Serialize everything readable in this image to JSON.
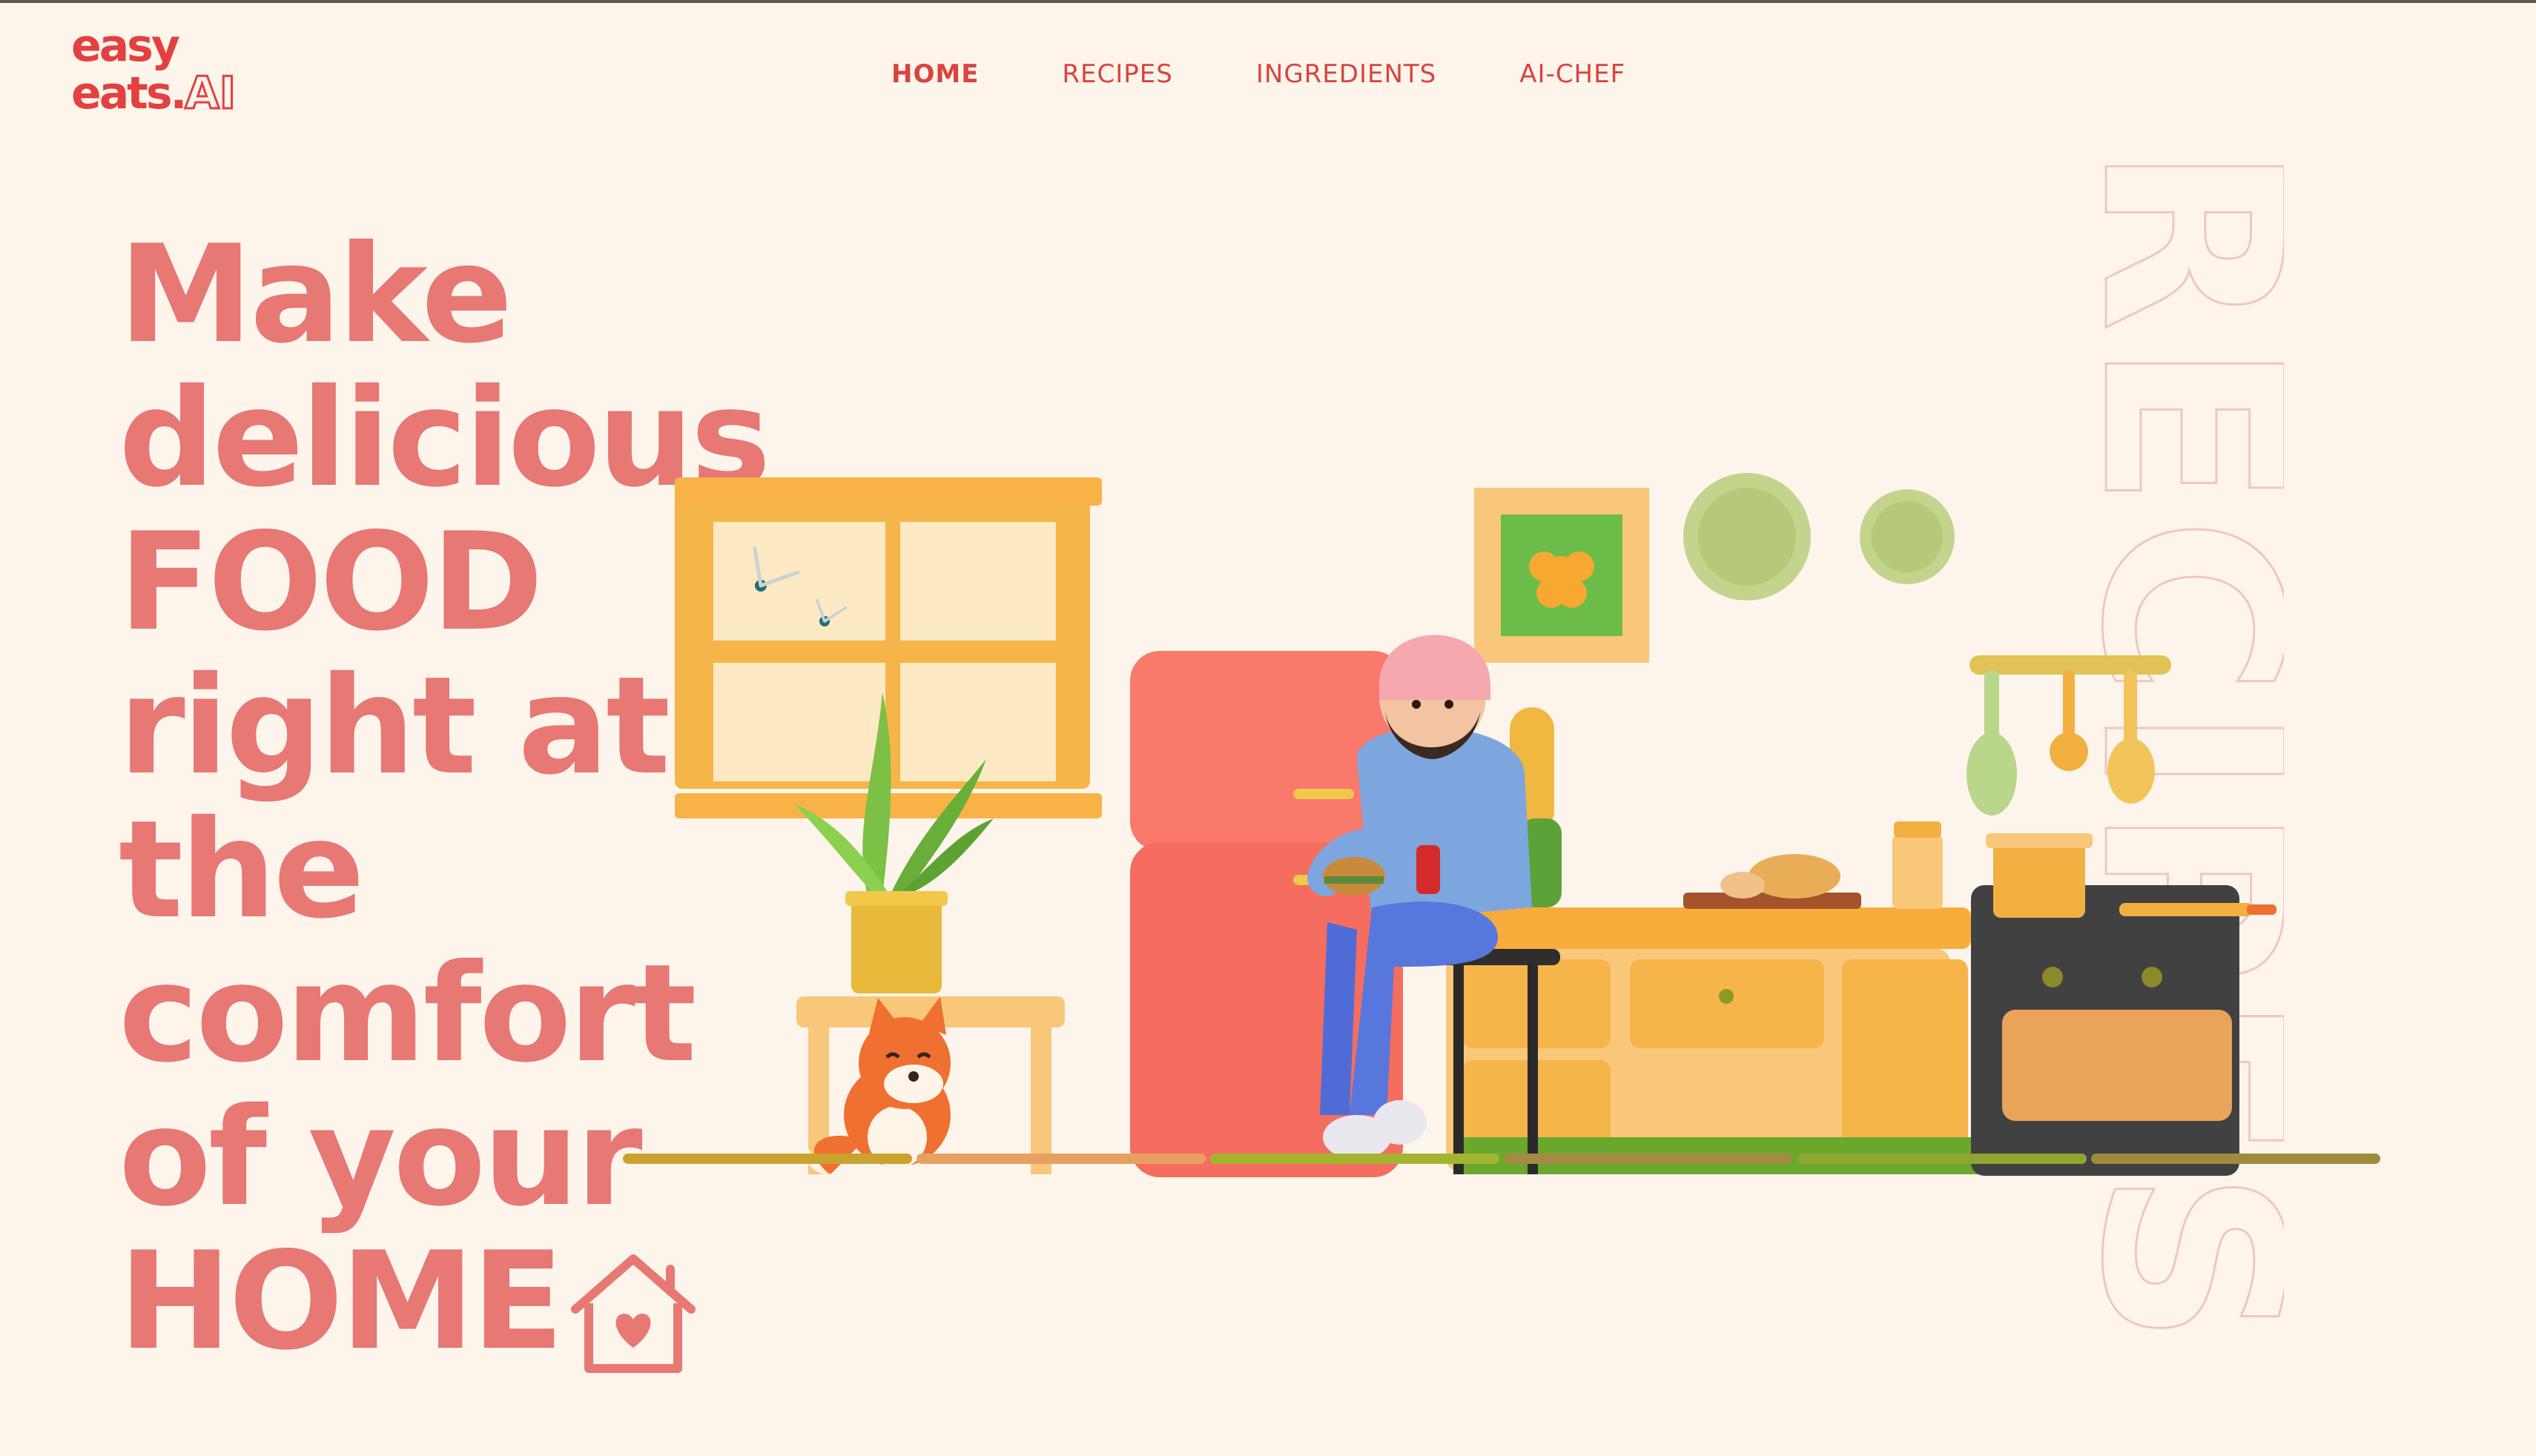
{
  "logo": {
    "line1": "easy",
    "line2_text": "eats.",
    "line2_suffix": "AI"
  },
  "nav": {
    "items": [
      {
        "label": "HOME",
        "active": true
      },
      {
        "label": "RECIPES",
        "active": false
      },
      {
        "label": "INGREDIENTS",
        "active": false
      },
      {
        "label": "AI-CHEF",
        "active": false
      }
    ]
  },
  "hero": {
    "lines": [
      "Make",
      "delicious",
      "FOOD",
      "right at",
      "the",
      "comfort",
      "of your",
      "HOME"
    ]
  },
  "side_word": "RECIPES",
  "colors": {
    "background": "#fdf5eb",
    "brand": "#e2413f",
    "hero_text": "#e77874",
    "outline_text": "#f0c6c0"
  },
  "icons": {
    "home": "house-heart-icon"
  }
}
